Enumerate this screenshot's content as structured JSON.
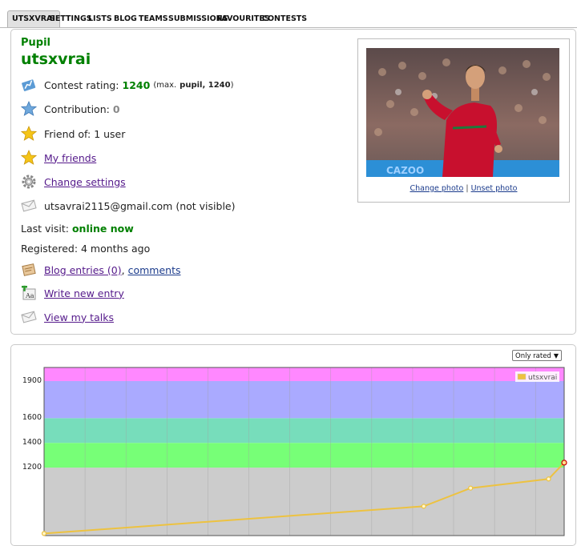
{
  "tabs": [
    "UTSXVRAI",
    "SETTINGS",
    "LISTS",
    "BLOG",
    "TEAMS",
    "SUBMISSIONS",
    "FAVOURITES",
    "CONTESTS"
  ],
  "profile": {
    "rank": "Pupil",
    "handle": "utsxvrai",
    "rating_label": "Contest rating:",
    "rating_value": "1240",
    "rating_max_prefix": "(max.",
    "rating_max_rank": "pupil, 1240",
    "rating_max_suffix": ")",
    "contribution_label": "Contribution:",
    "contribution_value": "0",
    "friend_of": "Friend of: 1 user",
    "my_friends": "My friends",
    "change_settings": "Change settings",
    "email": "utsavrai2115@gmail.com (not visible)",
    "last_visit_label": "Last visit:",
    "last_visit_value": "online now",
    "registered": "Registered: 4 months ago",
    "blog_entries": "Blog entries (0)",
    "comments": "comments",
    "write_new_entry": "Write new entry",
    "view_my_talks": "View my talks",
    "change_photo": "Change photo",
    "photo_sep": "|",
    "unset_photo": "Unset photo"
  },
  "rating_graph": {
    "filter": "Only rated",
    "legend": "utsxvrai"
  },
  "colors": {
    "rank_green": "#008000",
    "band_pink": "#ff88ff",
    "band_blue": "#aaaaff",
    "band_cyan": "#77ddbb",
    "band_green": "#77ff77",
    "band_gray": "#cccccc",
    "line": "#edc240"
  },
  "chart_data": {
    "type": "line",
    "title": "",
    "xlabel": "",
    "ylabel": "",
    "yticks": [
      1200,
      1400,
      1600,
      1900
    ],
    "ylim": [
      650,
      2010
    ],
    "bands": [
      {
        "from": 650,
        "to": 1200,
        "color": "#cccccc"
      },
      {
        "from": 1200,
        "to": 1400,
        "color": "#77ff77"
      },
      {
        "from": 1400,
        "to": 1600,
        "color": "#77ddbb"
      },
      {
        "from": 1600,
        "to": 1900,
        "color": "#aaaaff"
      },
      {
        "from": 1900,
        "to": 2010,
        "color": "#ff88ff"
      }
    ],
    "series": [
      {
        "name": "utsxvrai",
        "values": [
          667,
          887,
          1034,
          1108,
          1240
        ]
      }
    ],
    "x": [
      0,
      0.73,
      0.82,
      0.97,
      1.0
    ],
    "legend_position": "top-right",
    "grid": true
  }
}
